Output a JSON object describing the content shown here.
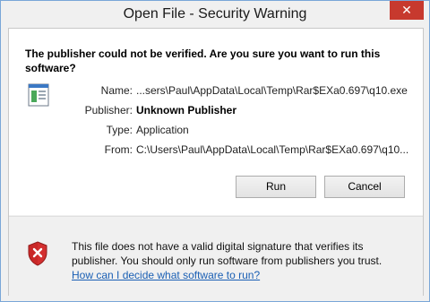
{
  "window": {
    "title": "Open File - Security Warning",
    "close_glyph": "✕"
  },
  "prompt": {
    "question": "The publisher could not be verified.  Are you sure you want to run this software?"
  },
  "details": [
    {
      "label": "Name:",
      "value": "...sers\\Paul\\AppData\\Local\\Temp\\Rar$EXa0.697\\q10.exe"
    },
    {
      "label": "Publisher:",
      "value": "Unknown Publisher"
    },
    {
      "label": "Type:",
      "value": "Application"
    },
    {
      "label": "From:",
      "value": "C:\\Users\\Paul\\AppData\\Local\\Temp\\Rar$EXa0.697\\q10..."
    }
  ],
  "buttons": {
    "run": "Run",
    "cancel": "Cancel"
  },
  "warning": {
    "text": "This file does not have a valid digital signature that verifies its publisher.  You should only run software from publishers you trust.",
    "link": "How can I decide what software to run?"
  },
  "colors": {
    "close": "#c7392e",
    "link": "#1a5fb4",
    "shield": "#d32f2f"
  }
}
